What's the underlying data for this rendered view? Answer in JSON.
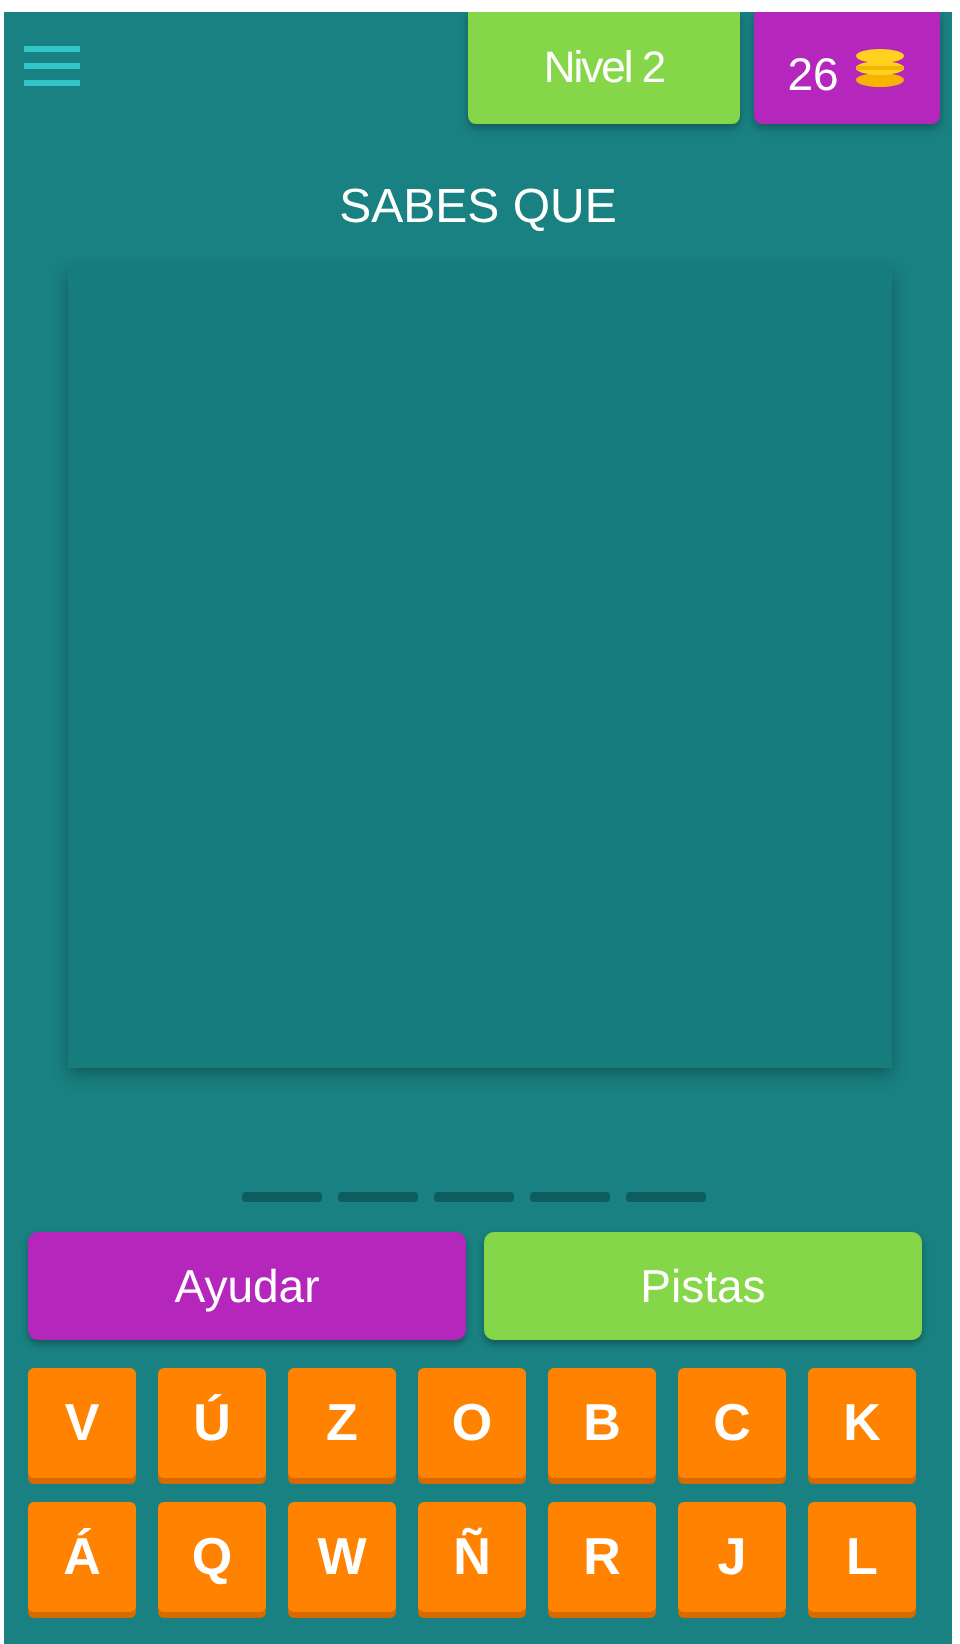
{
  "header": {
    "level_label": "Nivel 2",
    "coins": "26"
  },
  "title": "SABES QUE",
  "answer": {
    "slots": [
      {
        "filled": false
      },
      {
        "filled": false
      },
      {
        "filled": false
      },
      {
        "filled": false
      },
      {
        "filled": false
      }
    ]
  },
  "buttons": [
    {
      "label": "Ayudar",
      "kind": "help"
    },
    {
      "label": "Pistas",
      "kind": "hints"
    }
  ],
  "keyboard": {
    "rows": [
      [
        "V",
        "Ú",
        "Z",
        "O",
        "B",
        "C",
        "K"
      ],
      [
        "Á",
        "Q",
        "W",
        "Ñ",
        "R",
        "J",
        "L"
      ]
    ]
  }
}
